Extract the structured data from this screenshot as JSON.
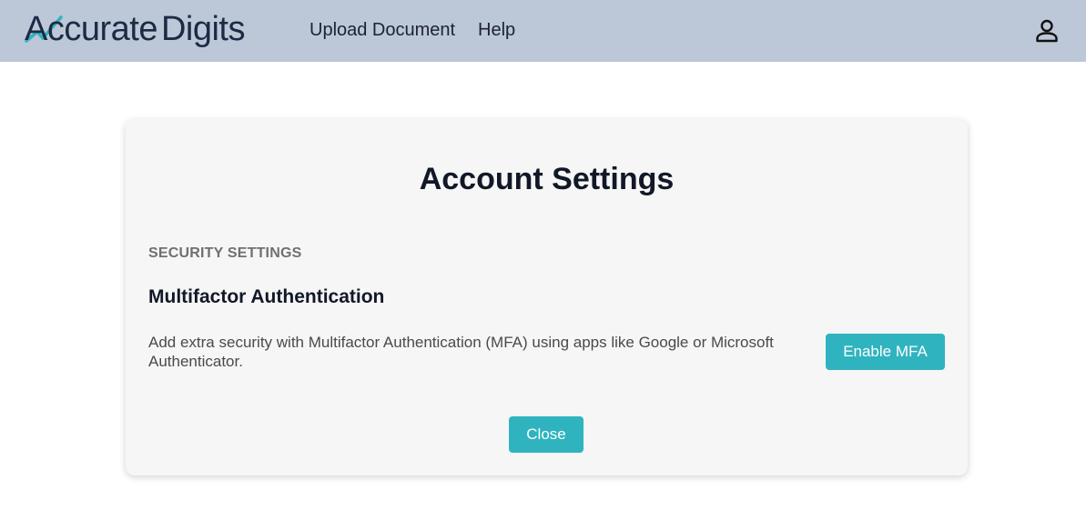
{
  "header": {
    "logo": {
      "part1": "Accurate",
      "part2": "Digits"
    },
    "nav": [
      {
        "label": "Upload Document"
      },
      {
        "label": "Help"
      }
    ],
    "user_icon": "user-icon",
    "background": "#bcc7d8"
  },
  "card": {
    "title": "Account Settings",
    "section_label": "SECURITY SETTINGS",
    "mfa": {
      "heading": "Multifactor Authentication",
      "description": "Add extra security with Multifactor Authentication (MFA) using apps like Google or Microsoft Authenticator.",
      "enable_label": "Enable MFA"
    },
    "close_label": "Close"
  },
  "colors": {
    "accent": "#2fb4bf",
    "logo_check": "#2fb4bf",
    "logo_text": "#1c2a44"
  }
}
